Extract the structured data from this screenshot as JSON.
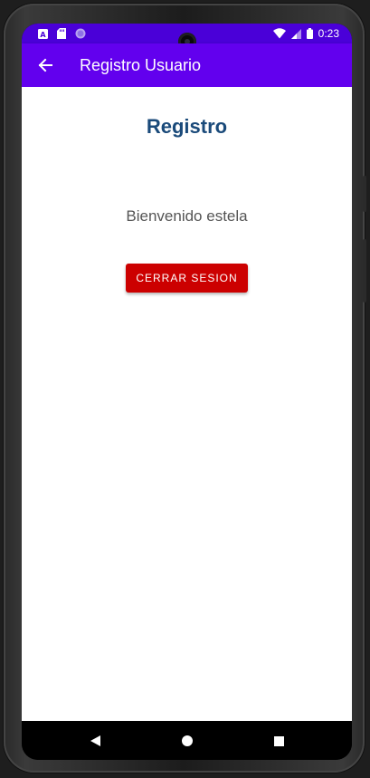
{
  "status_bar": {
    "time": "0:23",
    "icons": [
      "a-notification-icon",
      "sd-card-icon",
      "circle-notification-icon",
      "wifi-icon",
      "signal-icon",
      "battery-icon"
    ],
    "color": "#4a00d8"
  },
  "app_bar": {
    "title": "Registro Usuario",
    "back_icon": "arrow-back-icon",
    "color": "#6200ee"
  },
  "main": {
    "title": "Registro",
    "title_color": "#1a4a7a",
    "welcome_text": "Bienvenido estela",
    "logout_label": "CERRAR SESION",
    "logout_color": "#cc0000"
  },
  "nav_bar": {
    "icons": [
      "back-triangle-icon",
      "home-circle-icon",
      "recents-square-icon"
    ]
  }
}
